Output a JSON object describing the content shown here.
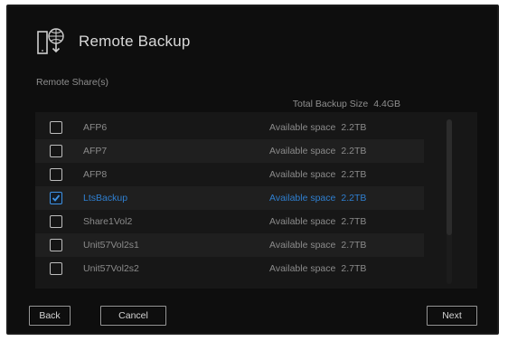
{
  "dialog": {
    "title": "Remote Backup",
    "title_icon": "remote-backup-icon",
    "section_label": "Remote Share(s)",
    "total_backup_label": "Total Backup Size",
    "total_backup_value": "4.4GB"
  },
  "shares": [
    {
      "name": "AFP6",
      "avail_label": "Available space",
      "avail_value": "2.2TB",
      "checked": false
    },
    {
      "name": "AFP7",
      "avail_label": "Available space",
      "avail_value": "2.2TB",
      "checked": false
    },
    {
      "name": "AFP8",
      "avail_label": "Available space",
      "avail_value": "2.2TB",
      "checked": false
    },
    {
      "name": "LtsBackup",
      "avail_label": "Available space",
      "avail_value": "2.2TB",
      "checked": true
    },
    {
      "name": "Share1Vol2",
      "avail_label": "Available space",
      "avail_value": "2.7TB",
      "checked": false
    },
    {
      "name": "Unit57Vol2s1",
      "avail_label": "Available space",
      "avail_value": "2.7TB",
      "checked": false
    },
    {
      "name": "Unit57Vol2s2",
      "avail_label": "Available space",
      "avail_value": "2.7TB",
      "checked": false
    }
  ],
  "buttons": {
    "back": "Back",
    "cancel": "Cancel",
    "next": "Next"
  },
  "colors": {
    "accent": "#2f7fd0",
    "background": "#0e0e0e"
  }
}
